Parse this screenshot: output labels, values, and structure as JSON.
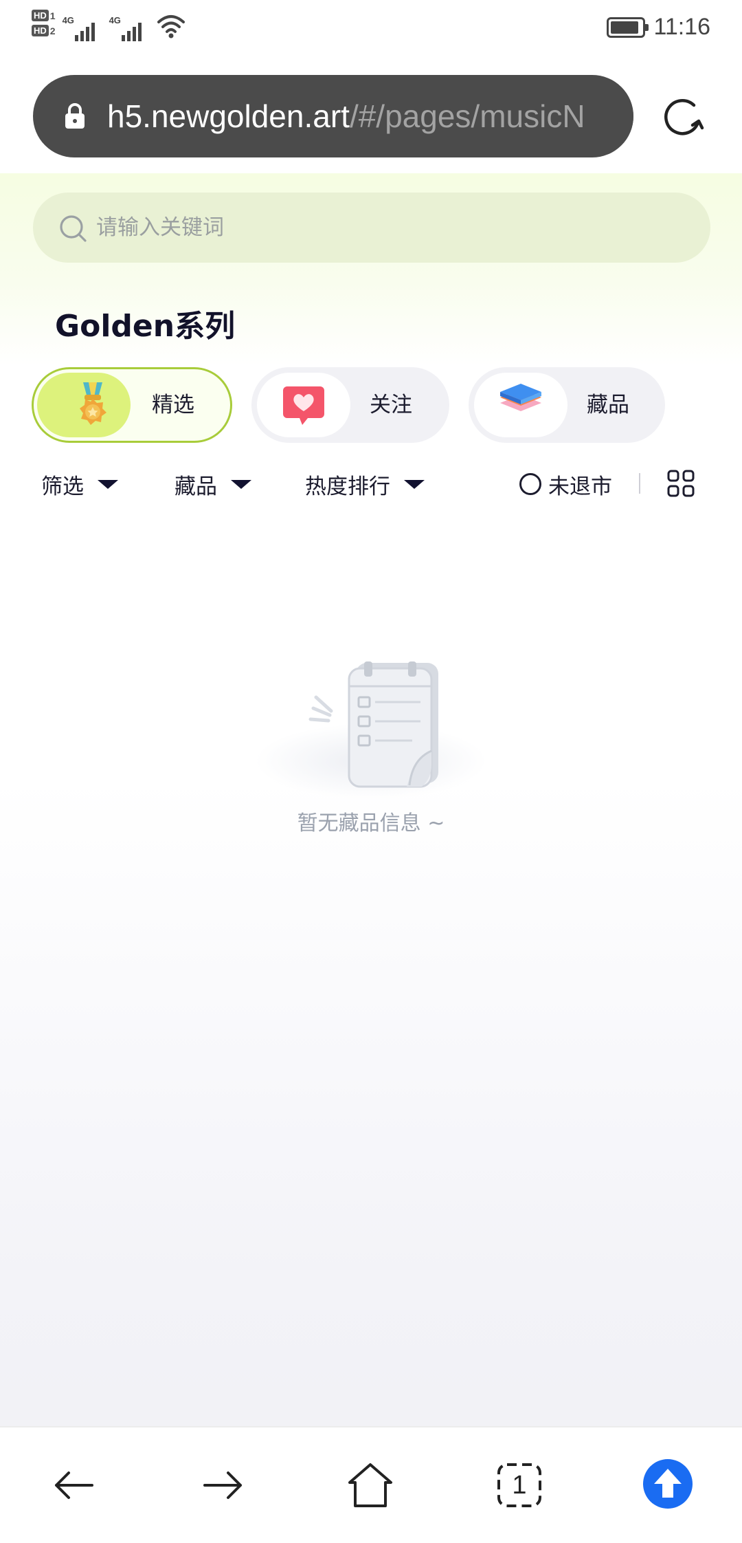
{
  "status_bar": {
    "sim1_badge": "HD",
    "sim1_num": "1",
    "sim2_badge": "HD",
    "sim2_num": "2",
    "net1": "4G",
    "net2": "4G",
    "time": "11:16"
  },
  "browser": {
    "url_host": "h5.newgolden.art",
    "url_path": "/#/pages/musicN"
  },
  "search": {
    "placeholder": "请输入关键词"
  },
  "page_title": "Golden系列",
  "tabs": [
    {
      "label": "精选",
      "icon": "medal-icon",
      "active": true
    },
    {
      "label": "关注",
      "icon": "heart-icon",
      "active": false
    },
    {
      "label": "藏品",
      "icon": "stack-icon",
      "active": false
    }
  ],
  "filters": {
    "filter_label": "筛选",
    "collection_label": "藏品",
    "sort_label": "热度排行",
    "unlisted_label": "未退市"
  },
  "empty_state": {
    "message": "暂无藏品信息 ~"
  },
  "app_nav": [
    {
      "icon": "home-icon",
      "active": false
    },
    {
      "icon": "market-bag-icon",
      "active": true
    },
    {
      "icon": "box-icon",
      "active": false
    },
    {
      "icon": "profile-face-icon",
      "active": false
    }
  ],
  "browser_bar": {
    "tab_count": "1"
  },
  "colors": {
    "accent_green": "#a8cc3a",
    "accent_lime": "#ddf27c",
    "nav_active_icon": "#14123a",
    "browser_upload_blue": "#1a6cf2"
  }
}
